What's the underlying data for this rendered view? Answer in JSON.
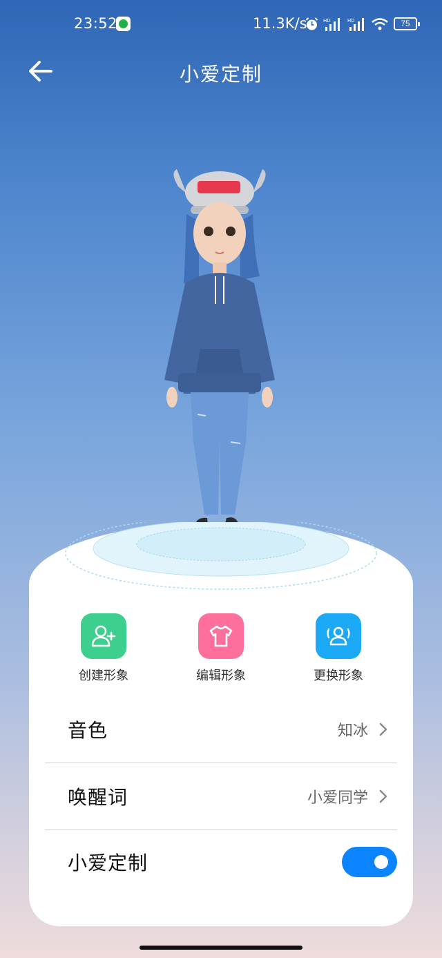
{
  "status_bar": {
    "time": "23:52",
    "net_speed": "11.3K/s",
    "battery": "75",
    "icons": [
      "app-badge-icon",
      "alarm-icon",
      "hd-signal-icon",
      "hd-signal-icon",
      "wifi-icon",
      "battery-icon"
    ]
  },
  "header": {
    "title": "小爱定制",
    "back_icon": "back-arrow-icon"
  },
  "actions": [
    {
      "label": "创建形象",
      "icon": "add-user-icon",
      "color": "#3ccf8e"
    },
    {
      "label": "编辑形象",
      "icon": "shirt-icon",
      "color": "#ff6f9c"
    },
    {
      "label": "更换形象",
      "icon": "switch-user-icon",
      "color": "#1ba8f5"
    }
  ],
  "settings": {
    "voice": {
      "label": "音色",
      "value": "知冰"
    },
    "wake_word": {
      "label": "唤醒词",
      "value": "小爱同学"
    },
    "custom": {
      "label": "小爱定制",
      "enabled": true
    }
  },
  "colors": {
    "toggle_on": "#0d84ff",
    "bg_top": "#2f66b6",
    "bg_bottom": "#efdcdc"
  }
}
